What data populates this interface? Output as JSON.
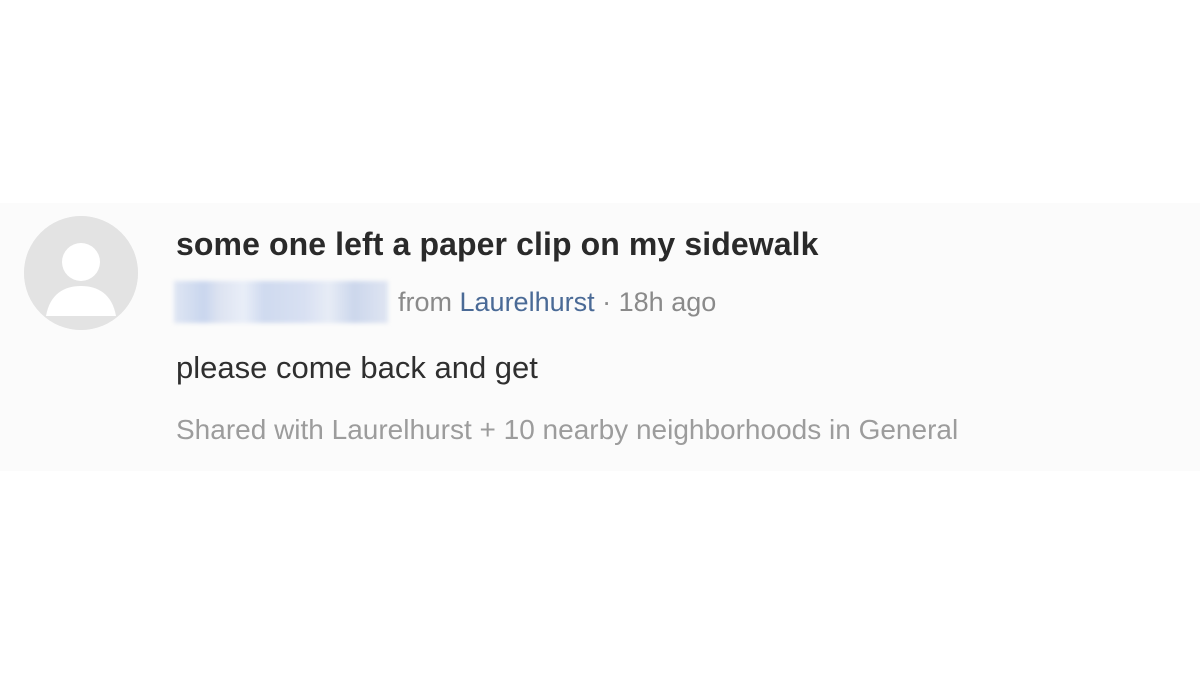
{
  "post": {
    "title": "some one left a paper clip on my sidewalk",
    "author_prefix": "from",
    "neighborhood": "Laurelhurst",
    "separator": "·",
    "time": "18h ago",
    "body": "please come back and get",
    "shared": "Shared with Laurelhurst + 10 nearby neighborhoods in General"
  },
  "colors": {
    "link": "#4a6a96",
    "title": "#2a2a2a",
    "muted": "#9c9c9c",
    "avatar_bg": "#e3e3e3"
  },
  "icons": {
    "avatar": "default-user-icon"
  }
}
